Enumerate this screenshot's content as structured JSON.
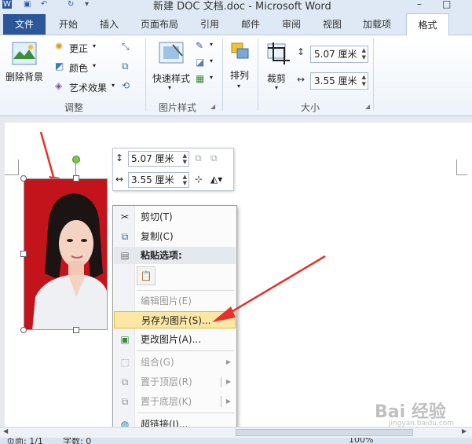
{
  "window": {
    "title": "新建 DOC 文档.doc - Microsoft Word"
  },
  "tabs": [
    {
      "label": "文件"
    },
    {
      "label": "开始"
    },
    {
      "label": "插入"
    },
    {
      "label": "页面布局"
    },
    {
      "label": "引用"
    },
    {
      "label": "邮件"
    },
    {
      "label": "审阅"
    },
    {
      "label": "视图"
    },
    {
      "label": "加载项"
    },
    {
      "label": "格式"
    }
  ],
  "ribbon": {
    "remove_background": "删除背景",
    "corrections": "更正",
    "color": "颜色",
    "artistic_effects": "艺术效果",
    "group_adjust": "调整",
    "quick_styles": "快速样式",
    "group_picture_styles": "图片样式",
    "arrange": "排列",
    "crop": "裁剪",
    "height_value": "5.07 厘米",
    "width_value": "3.55 厘米",
    "group_size": "大小"
  },
  "mini_toolbar": {
    "height_value": "5.07 厘米",
    "width_value": "3.55 厘米"
  },
  "context_menu": {
    "cut": "剪切(T)",
    "copy": "复制(C)",
    "paste_options": "粘贴选项:",
    "edit_picture": "编辑图片(E)",
    "save_as_picture": "另存为图片(S)...",
    "change_picture": "更改图片(A)...",
    "group": "组合(G)",
    "bring_to_front": "置于顶层(R)",
    "send_to_back": "置于底层(K)",
    "hyperlink": "超链接(I)..."
  },
  "status": {
    "page": "页面: 1/1",
    "words": "字数: 0",
    "zoom": "100%"
  },
  "watermark": {
    "text": "Bai 经验",
    "sub": "jingyan.baidu.com"
  },
  "colors": {
    "accent": "#2b579a",
    "photo_bg": "#c4141b",
    "highlight": "#fde7a4",
    "arrow": "#e8312a"
  }
}
